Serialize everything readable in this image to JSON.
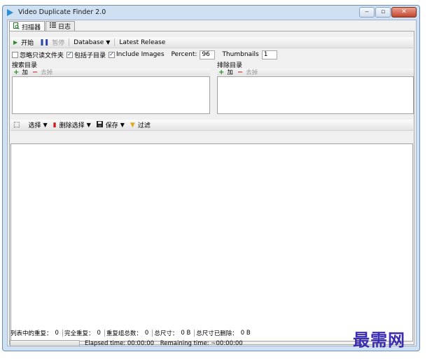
{
  "window": {
    "title": "Video Duplicate Finder 2.0",
    "min_glyph": "‒",
    "max_glyph": "▫",
    "close_glyph": "✕"
  },
  "tabs": [
    {
      "label": "扫描器",
      "icon": "search-doc-icon"
    },
    {
      "label": "日志",
      "icon": "list-icon"
    }
  ],
  "toolbar": {
    "start_label": "开始",
    "pause_label": "暂停",
    "database_label": "Database",
    "latest_release_label": "Latest Release"
  },
  "options": {
    "ignore_readonly_label": "忽略只读文件夹",
    "ignore_readonly_checked": false,
    "include_subdirs_label": "包括子目录",
    "include_subdirs_checked": true,
    "include_images_label": "Include Images",
    "include_images_checked": true,
    "percent_label": "Percent:",
    "percent_value": "96",
    "thumbnails_label": "Thumbnails",
    "thumbnails_value": "1"
  },
  "search_dirs": {
    "title": "搜索目录",
    "add_label": "加",
    "remove_label": "去掉"
  },
  "exclude_dirs": {
    "title": "排除目录",
    "add_label": "加",
    "remove_label": "去掉"
  },
  "results_toolbar": {
    "select_label": "选择",
    "delete_selection_label": "删除选择",
    "save_label": "保存",
    "filter_label": "过滤"
  },
  "status": {
    "duplicates_in_list_label": "列表中的重复：",
    "duplicates_in_list_value": "0",
    "full_duplicates_label": "完全重复：",
    "full_duplicates_value": "0",
    "duplicate_groups_label": "重复组总数：",
    "duplicate_groups_value": "0",
    "total_size_label": "总尺寸：",
    "total_size_value": "0 B",
    "total_deleted_label": "总尺寸已删除：",
    "total_deleted_value": "0 B",
    "elapsed_label": "Elapsed time:",
    "elapsed_value": "00:00:00",
    "remaining_label": "Remaining time:",
    "remaining_value": "~00:00:00"
  },
  "progress": {
    "value": 0
  },
  "watermark": "最需网",
  "colors": {
    "accent": "#2b8fd8",
    "add_green": "#2a8a2a",
    "remove_red": "#c0392b",
    "watermark": "#3a2cae"
  }
}
